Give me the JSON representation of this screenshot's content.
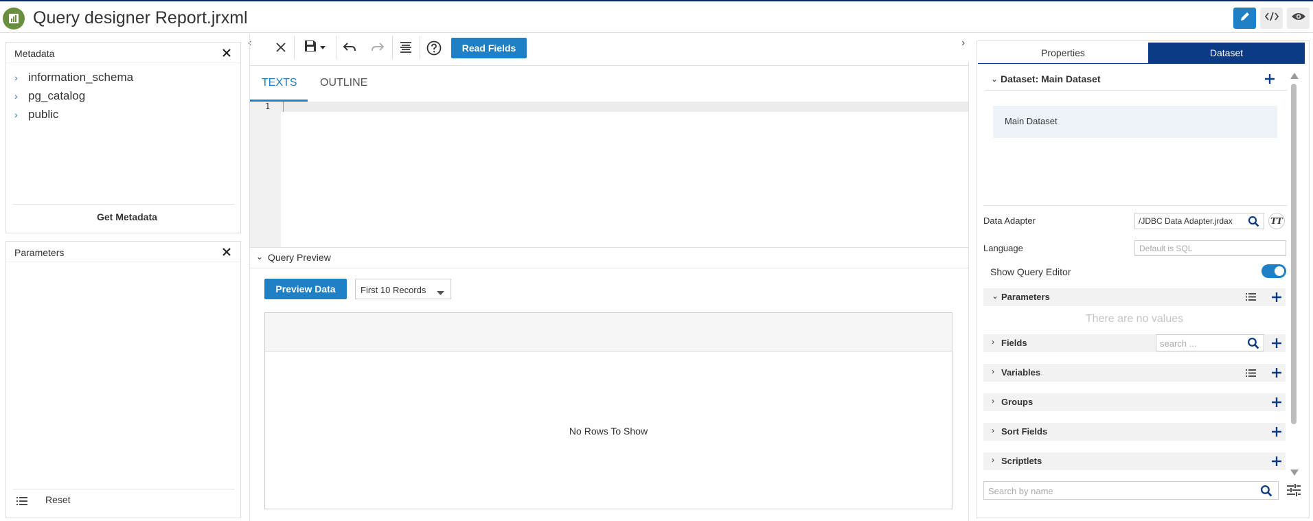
{
  "header": {
    "title": "Query designer Report.jrxml",
    "icons": [
      "report-logo-icon",
      "pencil-icon",
      "code-icon",
      "eye-icon"
    ]
  },
  "metadata_panel": {
    "title": "Metadata",
    "items": [
      "information_schema",
      "pg_catalog",
      "public"
    ],
    "action": "Get Metadata"
  },
  "parameters_panel": {
    "title": "Parameters",
    "reset": "Reset"
  },
  "toolbar": {
    "read_fields": "Read Fields",
    "icons": [
      "close-icon",
      "save-icon",
      "undo-icon",
      "redo-icon",
      "format-icon",
      "help-icon"
    ]
  },
  "editor": {
    "tabs": [
      "TEXTS",
      "OUTLINE"
    ],
    "active_tab": "TEXTS",
    "line_number": "1"
  },
  "query_preview": {
    "title": "Query Preview",
    "preview_button": "Preview Data",
    "records_select": "First 10 Records",
    "empty_text": "No Rows To Show"
  },
  "right_panel": {
    "tabs": [
      "Properties",
      "Dataset"
    ],
    "active_tab": "Dataset",
    "dataset_header": "Dataset: Main Dataset",
    "dataset_item": "Main Dataset",
    "data_adapter_label": "Data Adapter",
    "data_adapter_value": "/JDBC Data Adapter.jrdax",
    "language_label": "Language",
    "language_placeholder": "Default is SQL",
    "show_query_editor_label": "Show Query Editor",
    "show_query_editor_on": true,
    "sections": {
      "parameters": "Parameters",
      "fields": "Fields",
      "variables": "Variables",
      "groups": "Groups",
      "sort_fields": "Sort Fields",
      "scriptlets": "Scriptlets"
    },
    "no_values": "There are no values",
    "fields_search_placeholder": "search ...",
    "search_placeholder": "Search by name"
  },
  "colors": {
    "accent": "#1f80c6",
    "dark_accent": "#0b3b84",
    "logo": "#6a8e3f"
  }
}
